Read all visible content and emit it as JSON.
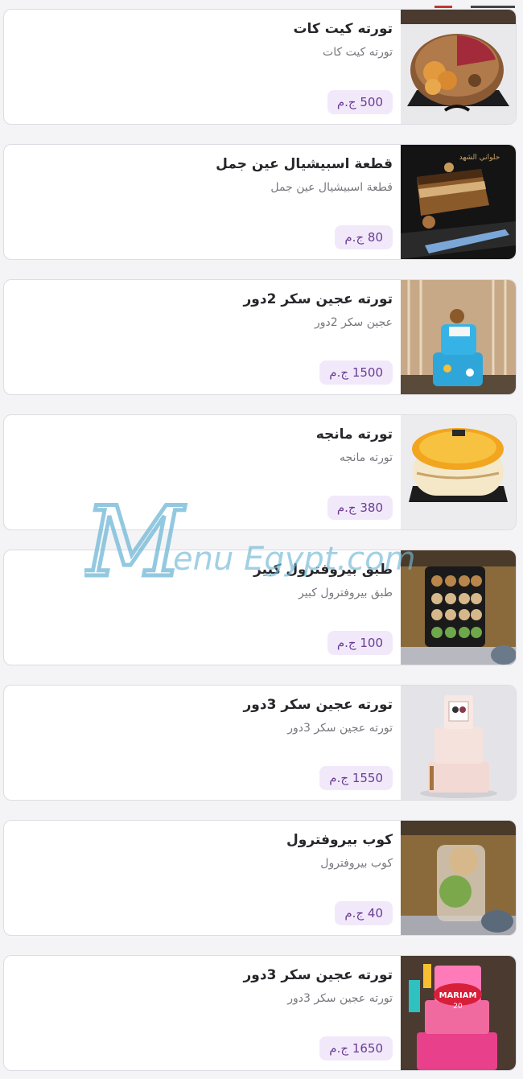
{
  "items": [
    {
      "title": "تورته كيت كات",
      "description": "تورته كيت كات",
      "price": "500 ج.م",
      "image": "cake-kitkat"
    },
    {
      "title": "قطعة اسبيشيال عين جمل",
      "description": "قطعة اسبيشيال عين جمل",
      "price": "80 ج.م",
      "image": "walnut-slice"
    },
    {
      "title": "تورته عجين سكر 2دور",
      "description": "عجين سكر 2دور",
      "price": "1500 ج.م",
      "image": "fondant-2tier"
    },
    {
      "title": "تورته مانجه",
      "description": "تورته مانجه",
      "price": "380 ج.م",
      "image": "mango-cake"
    },
    {
      "title": "طبق بيروفترول كبير",
      "description": "طبق بيروفترول كبير",
      "price": "100 ج.م",
      "image": "profiterole-plate"
    },
    {
      "title": "تورته عجين سكر 3دور",
      "description": "تورته عجين سكر 3دور",
      "price": "1550 ج.م",
      "image": "fondant-3tier-white"
    },
    {
      "title": "كوب بيروفترول",
      "description": "كوب بيروفترول",
      "price": "40 ج.م",
      "image": "profiterole-cup"
    },
    {
      "title": "تورته عجين سكر 3دور",
      "description": "تورته عجين سكر 3دور",
      "price": "1650 ج.م",
      "image": "fondant-3tier-pink"
    }
  ],
  "watermark": {
    "text": "enu Egypt.com",
    "letter": "M"
  },
  "thumb_labels": {
    "walnut_brand": "حلواني الشهد",
    "cake_name": "MARIAM",
    "cake_age": "20"
  },
  "colors": {
    "price_bg": "#f1e9fa",
    "price_text": "#6b3b94",
    "watermark": "#6fb8d6"
  }
}
